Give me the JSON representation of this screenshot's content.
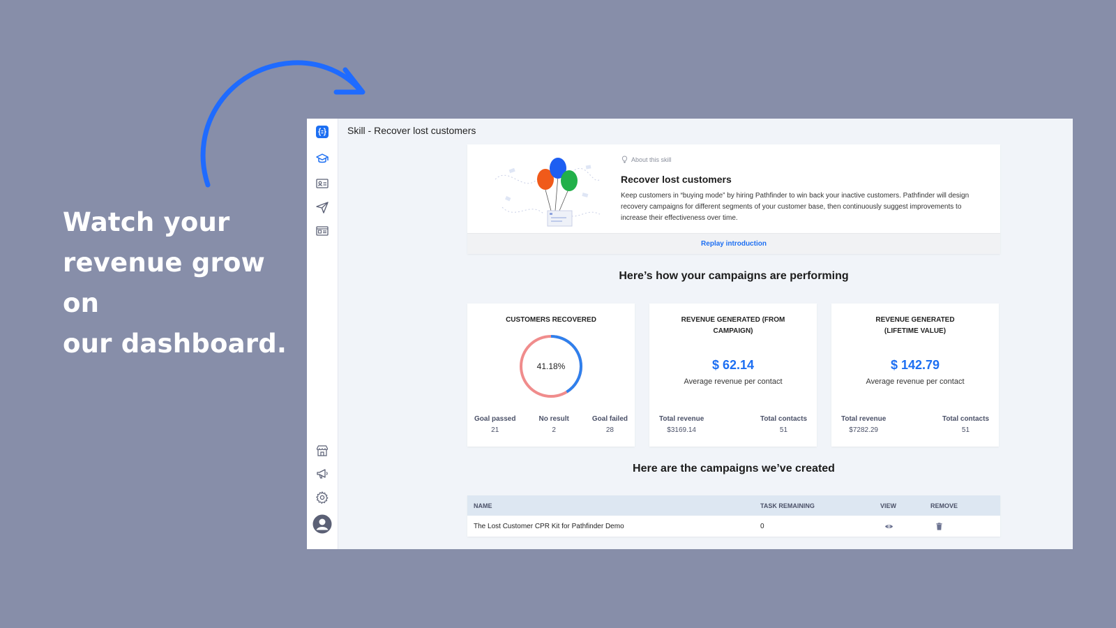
{
  "promo": {
    "line1": "Watch your",
    "line2": "revenue grow on",
    "line3": "our dashboard."
  },
  "colors": {
    "background": "#878ea9",
    "accent": "#1d6ff2",
    "donut_recovered": "#2f80ed",
    "donut_other": "#f08c8c"
  },
  "sidebar": {
    "top_icons": [
      "logo-icon",
      "graduation-cap-icon",
      "contact-card-icon",
      "paper-plane-icon",
      "newsletter-icon"
    ],
    "bottom_icons": [
      "storefront-icon",
      "megaphone-icon",
      "gear-icon",
      "user-avatar-icon"
    ]
  },
  "header": {
    "title": "Skill - Recover lost customers"
  },
  "about": {
    "tag": "About this skill",
    "title": "Recover lost customers",
    "description": "Keep customers in “buying mode” by hiring Pathfinder to win back your inactive customers. Pathfinder will design recovery campaigns for different segments of your customer base, then continuously suggest improvements to increase their effectiveness over time.",
    "replay_label": "Replay introduction"
  },
  "performance": {
    "title": "Here’s how your campaigns are performing",
    "customers": {
      "title": "CUSTOMERS RECOVERED",
      "percent_label": "41.18%",
      "percent": 41.18,
      "goal_passed_label": "Goal passed",
      "goal_passed": "21",
      "no_result_label": "No result",
      "no_result": "2",
      "goal_failed_label": "Goal failed",
      "goal_failed": "28"
    },
    "revenue_campaign": {
      "title": "REVENUE GENERATED (FROM CAMPAIGN)",
      "value": "$ 62.14",
      "subtitle": "Average revenue per contact",
      "total_revenue_label": "Total revenue",
      "total_revenue": "$3169.14",
      "total_contacts_label": "Total contacts",
      "total_contacts": "51"
    },
    "revenue_lifetime": {
      "title": "REVENUE GENERATED (LIFETIME VALUE)",
      "value": "$ 142.79",
      "subtitle": "Average revenue per contact",
      "total_revenue_label": "Total revenue",
      "total_revenue": "$7282.29",
      "total_contacts_label": "Total contacts",
      "total_contacts": "51"
    }
  },
  "campaigns": {
    "title": "Here are the campaigns we’ve created",
    "columns": {
      "name": "NAME",
      "task": "TASK REMAINING",
      "view": "VIEW",
      "remove": "REMOVE"
    },
    "rows": [
      {
        "name": "The Lost Customer CPR Kit for Pathfinder Demo",
        "task_remaining": "0",
        "view_icon": "eye-icon",
        "remove_icon": "trash-icon"
      }
    ]
  }
}
